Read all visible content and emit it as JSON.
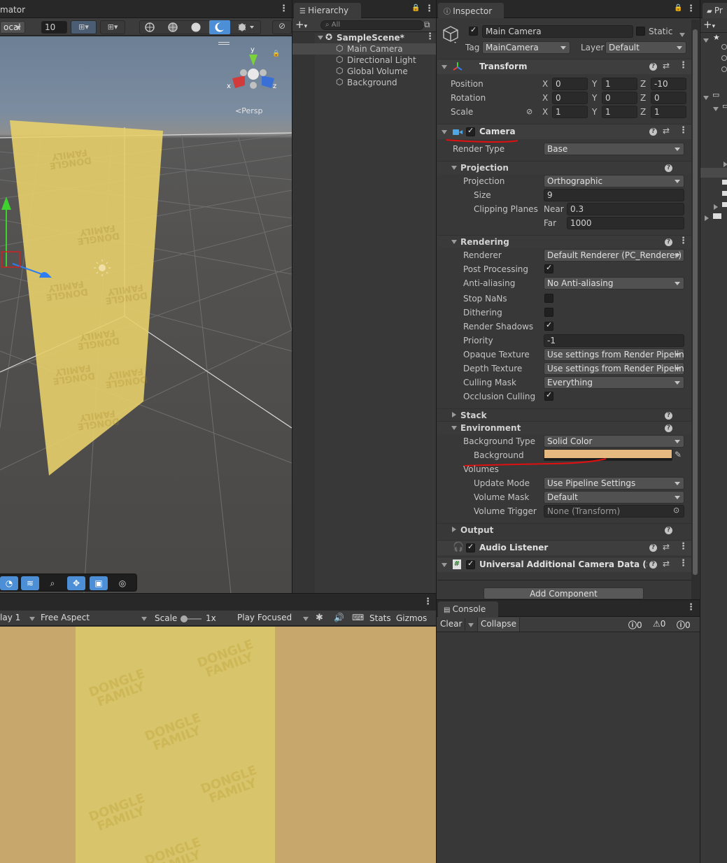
{
  "scene_toolbar": {
    "tab_label": "mator",
    "local_label": "ocal",
    "grid_value": "10",
    "persp_label": "Persp"
  },
  "hierarchy": {
    "tab_label": "Hierarchy",
    "search_placeholder": "All",
    "items": [
      {
        "label": "SampleScene*"
      },
      {
        "label": "Main Camera"
      },
      {
        "label": "Directional Light"
      },
      {
        "label": "Global Volume"
      },
      {
        "label": "Background"
      }
    ]
  },
  "inspector": {
    "tab_label": "Inspector",
    "object_name": "Main Camera",
    "static_label": "Static",
    "tag_label": "Tag",
    "tag_value": "MainCamera",
    "layer_label": "Layer",
    "layer_value": "Default",
    "transform": {
      "title": "Transform",
      "position_label": "Position",
      "rotation_label": "Rotation",
      "scale_label": "Scale",
      "axis_x": "X",
      "axis_y": "Y",
      "axis_z": "Z",
      "position": {
        "x": "0",
        "y": "1",
        "z": "-10"
      },
      "rotation": {
        "x": "0",
        "y": "0",
        "z": "0"
      },
      "scale": {
        "x": "1",
        "y": "1",
        "z": "1"
      }
    },
    "camera": {
      "title": "Camera",
      "render_type_label": "Render Type",
      "render_type_value": "Base",
      "projection_section": "Projection",
      "projection_label": "Projection",
      "projection_value": "Orthographic",
      "size_label": "Size",
      "size_value": "9",
      "clipping_label": "Clipping Planes",
      "near_label": "Near",
      "near_value": "0.3",
      "far_label": "Far",
      "far_value": "1000",
      "rendering_section": "Rendering",
      "renderer_label": "Renderer",
      "renderer_value": "Default Renderer (PC_Renderer)",
      "post_processing_label": "Post Processing",
      "antialiasing_label": "Anti-aliasing",
      "antialiasing_value": "No Anti-aliasing",
      "stop_nans_label": "Stop NaNs",
      "dithering_label": "Dithering",
      "render_shadows_label": "Render Shadows",
      "priority_label": "Priority",
      "priority_value": "-1",
      "opaque_texture_label": "Opaque Texture",
      "opaque_texture_value": "Use settings from Render Pipelin",
      "depth_texture_label": "Depth Texture",
      "depth_texture_value": "Use settings from Render Pipelin",
      "culling_mask_label": "Culling Mask",
      "culling_mask_value": "Everything",
      "occlusion_culling_label": "Occlusion Culling",
      "stack_section": "Stack",
      "environment_section": "Environment",
      "background_type_label": "Background Type",
      "background_type_value": "Solid Color",
      "background_label": "Background",
      "background_color": "#e5b97f",
      "volumes_label": "Volumes",
      "update_mode_label": "Update Mode",
      "update_mode_value": "Use Pipeline Settings",
      "volume_mask_label": "Volume Mask",
      "volume_mask_value": "Default",
      "volume_trigger_label": "Volume Trigger",
      "volume_trigger_value": "None (Transform)",
      "output_section": "Output"
    },
    "audio_listener": {
      "title": "Audio Listener"
    },
    "additional_data": {
      "title": "Universal Additional Camera Data (Script"
    },
    "add_component_label": "Add Component"
  },
  "game_view": {
    "display_label": "lay 1",
    "aspect_label": "Free Aspect",
    "scale_label": "Scale",
    "scale_value": "1x",
    "play_focused_label": "Play Focused",
    "stats_label": "Stats",
    "gizmos_label": "Gizmos",
    "watermark_text": "DONGLE FAMILY"
  },
  "console": {
    "tab_label": "Console",
    "clear_label": "Clear",
    "collapse_label": "Collapse",
    "info_count": "0",
    "warn_count": "0",
    "error_count": "0"
  },
  "project": {
    "tab_label": "Pr"
  },
  "colors": {
    "annotation_red": "#e01010",
    "accent_blue": "#4d8fd6",
    "panel_bg": "#383838",
    "sprite_yellow": "#e7cf6a"
  }
}
